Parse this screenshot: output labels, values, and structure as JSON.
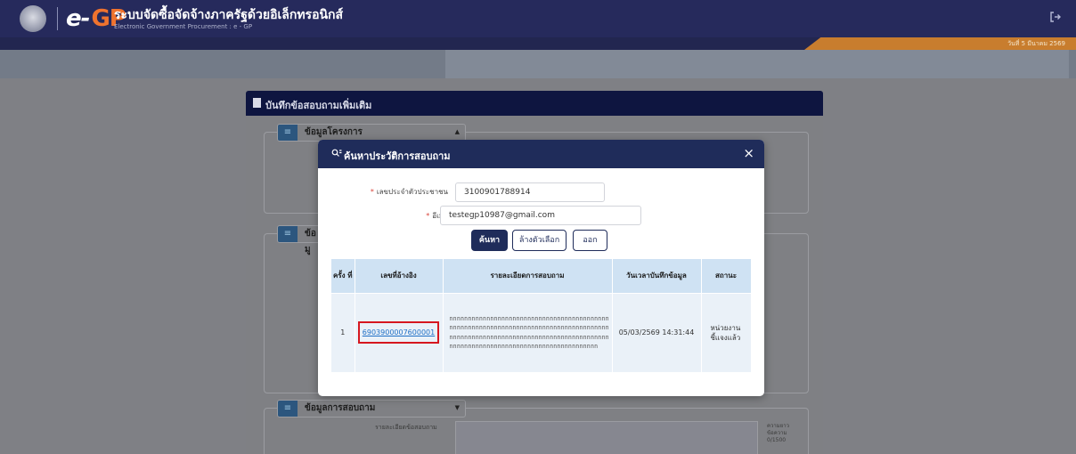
{
  "header": {
    "title": "ระบบจัดซื้อจัดจ้างภาครัฐด้วยอิเล็กทรอนิกส์",
    "subtitle": "Electronic Government Procurement : e - GP",
    "logo_text_e": "e-",
    "logo_text_gp": "GP",
    "date": "วันที่ 5 มีนาคม 2569",
    "logout_icon": "logout-icon"
  },
  "panel": {
    "title": "บันทึกข้อสอบถามเพิ่มเติม",
    "sections": [
      {
        "label": "ข้อมูลโครงการ"
      },
      {
        "label": "ข้อมู"
      },
      {
        "label": "ข้อมูลการสอบถาม",
        "field_label": "รายละเอียดข้อสอบถาม",
        "counter": "ความยาวข้อความ 0/1500"
      }
    ]
  },
  "modal": {
    "title": "ค้นหาประวัติการสอบถาม",
    "close_symbol": "×",
    "citizen_id_label": "เลขประจำตัวประชาชน",
    "citizen_id_value": "3100901788914",
    "email_label": "อีเมล",
    "email_value": "testegp10987@gmail.com",
    "required_mark": "*",
    "buttons": {
      "search": "ค้นหา",
      "clear": "ล้างตัวเลือก",
      "exit": "ออก"
    },
    "table": {
      "columns": [
        "ครั้ง ที่",
        "เลขที่อ้างอิง",
        "รายละเอียดการสอบถาม",
        "วันเวลาบันทึกข้อมูล",
        "สถานะ"
      ],
      "rows": [
        {
          "no": "1",
          "reference": "6903900007600001",
          "detail": "nnnnnnnnnnnnnnnnnnnnnnnnnnnnnnnnnnnnnnnnnnnnnnnnnnnnnnnnnnnnnnnnnnnnnnnnnnnnnnnnnnnnnnnnnnnnnnnnnnnnnnnnnnnnnnnnnnnnnnnnnnnnnnnnnnnnnnnnnnnnnnnnnnnnnnnnnnnnnnnnnnnnnnnnn",
          "datetime": "05/03/2569 14:31:44",
          "status": "หน่วยงานชี้แจงแล้ว"
        }
      ]
    }
  }
}
